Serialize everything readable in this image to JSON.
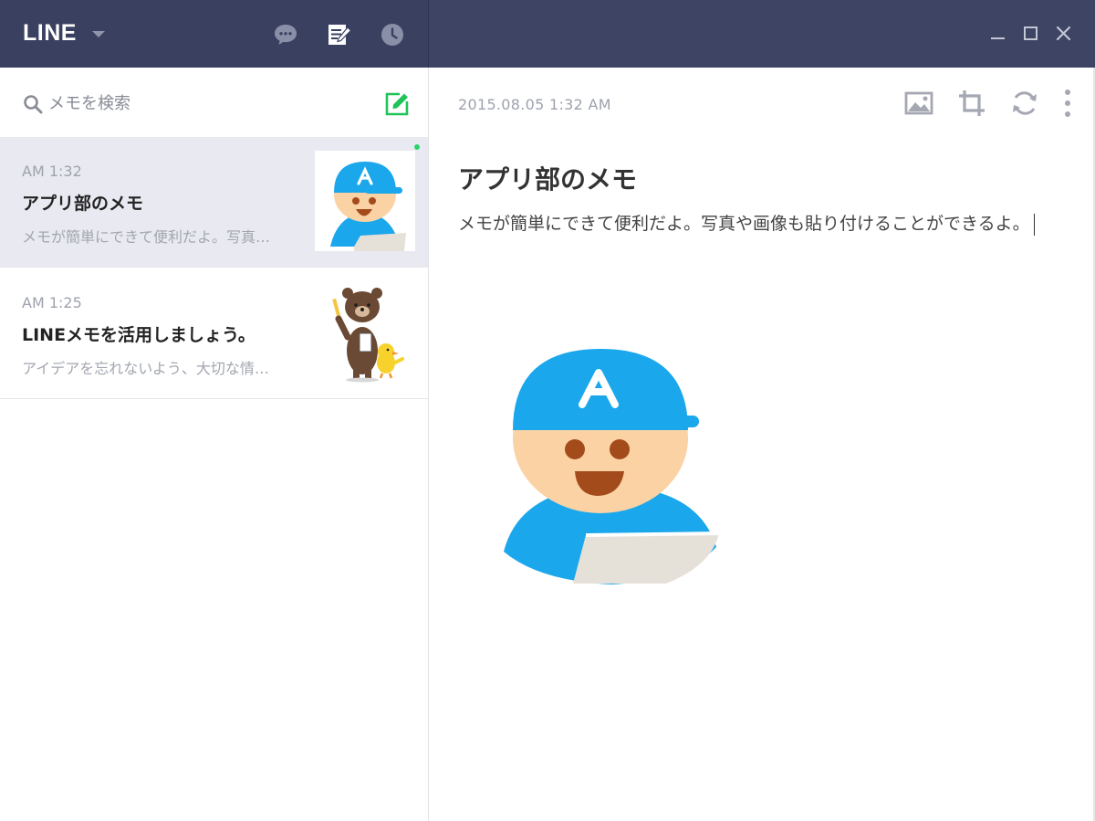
{
  "app": {
    "name": "LINE"
  },
  "titlebar": {
    "icons": [
      "chat-icon",
      "memo-icon",
      "clock-icon"
    ],
    "window_controls": [
      "minimize-icon",
      "maximize-icon",
      "close-icon"
    ]
  },
  "search": {
    "placeholder": "メモを検索"
  },
  "memos": [
    {
      "time": "AM 1:32",
      "title": "アプリ部のメモ",
      "preview": "メモが簡単にできて便利だよ。写真…",
      "thumbnail": "app-club-character",
      "active": true,
      "unread": true
    },
    {
      "time": "AM 1:25",
      "title": "LINEメモを活用しましょう。",
      "preview": "アイデアを忘れないよう、大切な情…",
      "thumbnail": "brown-and-sally-sticker",
      "active": false,
      "unread": false
    }
  ],
  "editor": {
    "date": "2015.08.05 1:32 AM",
    "title": "アプリ部のメモ",
    "body": "メモが簡単にできて便利だよ。写真や画像も貼り付けることができるよ。",
    "image": "app-club-character",
    "toolbar": [
      "image-icon",
      "crop-icon",
      "refresh-icon",
      "more-icon"
    ]
  },
  "colors": {
    "titlebar": "#3e4463",
    "accent_green": "#2bd26b",
    "active_item": "#e9eaf1",
    "character_blue": "#1ba7ec",
    "character_skin": "#fbd2a4"
  }
}
